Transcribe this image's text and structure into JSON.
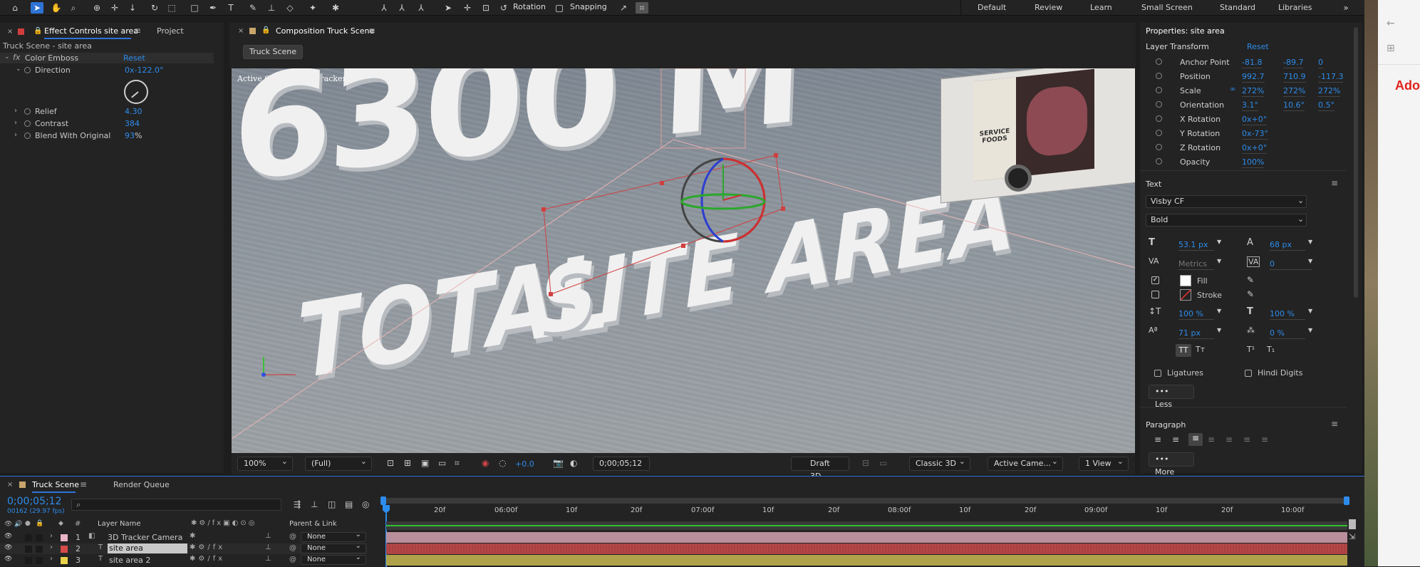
{
  "workspaces": [
    "Default",
    "Review",
    "Learn",
    "Small Screen",
    "Standard",
    "Libraries"
  ],
  "toolbar": {
    "rotation_label": "Rotation",
    "snapping_label": "Snapping"
  },
  "effect_controls": {
    "tab_label": "Effect Controls site area",
    "tab2_label": "Project",
    "subtitle": "Truck Scene - site area",
    "effect_name": "Color Emboss",
    "reset_label": "Reset",
    "params": [
      {
        "label": "Direction",
        "value": "0x-122.0°"
      },
      {
        "label": "Relief",
        "value": "4.30"
      },
      {
        "label": "Contrast",
        "value": "384"
      },
      {
        "label": "Blend With Original",
        "value": "93",
        "unit": "%"
      }
    ]
  },
  "composition": {
    "tab_label": "Composition Truck Scene",
    "scene_button": "Truck Scene",
    "camera_label": "Active Camera (3D Tracker Camera)",
    "headline_text": "6300 M",
    "floor_text_1": "TOTAL",
    "floor_text_2": "SITE AREA",
    "truck_text": "SERVICE FOODS"
  },
  "viewer_bar": {
    "zoom": "100%",
    "resolution": "(Full)",
    "exposure": "+0.0",
    "timecode": "0;00;05;12",
    "renderer": "Draft 3D",
    "renderer2": "Classic 3D",
    "camera": "Active Came...",
    "views": "1 View"
  },
  "timeline": {
    "tab_label": "Truck Scene",
    "tab2_label": "Render Queue",
    "timecode": "0;00;05;12",
    "fps_note": "00162 (29.97 fps)",
    "search_placeholder": "",
    "col_num": "#",
    "col_layer": "Layer Name",
    "col_parent": "Parent & Link",
    "ruler": [
      "20f",
      "06:00f",
      "10f",
      "20f",
      "07:00f",
      "10f",
      "20f",
      "08:00f",
      "10f",
      "20f",
      "09:00f",
      "10f",
      "20f",
      "10:00f"
    ],
    "layers": [
      {
        "num": "1",
        "name": "3D Tracker Camera",
        "parent": "None",
        "label_color": "#e8b4c8",
        "bar_color": "#b88f9b"
      },
      {
        "num": "2",
        "name": "site area",
        "parent": "None",
        "label_color": "#d64a4a",
        "bar_color": "#b64646"
      },
      {
        "num": "3",
        "name": "site area 2",
        "parent": "None",
        "label_color": "#e8d24a",
        "bar_color": "#b0a24a"
      }
    ]
  },
  "properties": {
    "title": "Properties: site area",
    "layer_transform": "Layer Transform",
    "reset_label": "Reset",
    "transform": [
      {
        "label": "Anchor Point",
        "v1": "-81.8",
        "v2": "-89.7",
        "v3": "0"
      },
      {
        "label": "Position",
        "v1": "992.7",
        "v2": "710.9",
        "v3": "-117.3"
      },
      {
        "label": "Scale",
        "v1": "272%",
        "v2": "272%",
        "v3": "272%"
      },
      {
        "label": "Orientation",
        "v1": "3.1°",
        "v2": "10.6°",
        "v3": "0.5°"
      },
      {
        "label": "X Rotation",
        "v1": "0x+0°"
      },
      {
        "label": "Y Rotation",
        "v1": "0x-73°"
      },
      {
        "label": "Z Rotation",
        "v1": "0x+0°"
      },
      {
        "label": "Opacity",
        "v1": "100%"
      }
    ],
    "text_section": "Text",
    "font": "Visby CF",
    "style": "Bold",
    "font_size": "53.1 px",
    "leading": "68 px",
    "kerning": "Metrics",
    "tracking": "0",
    "fill_label": "Fill",
    "stroke_label": "Stroke",
    "vscale": "100 %",
    "hscale": "100 %",
    "baseline": "71 px",
    "tsume": "0 %",
    "caps1": "TT",
    "caps2": "Tт",
    "sup": "T¹",
    "sub": "T₁",
    "ligatures": "Ligatures",
    "hindi": "Hindi Digits",
    "less_label": "Less",
    "paragraph_section": "Paragraph",
    "more_label": "More"
  },
  "browser_peek": "Ado"
}
